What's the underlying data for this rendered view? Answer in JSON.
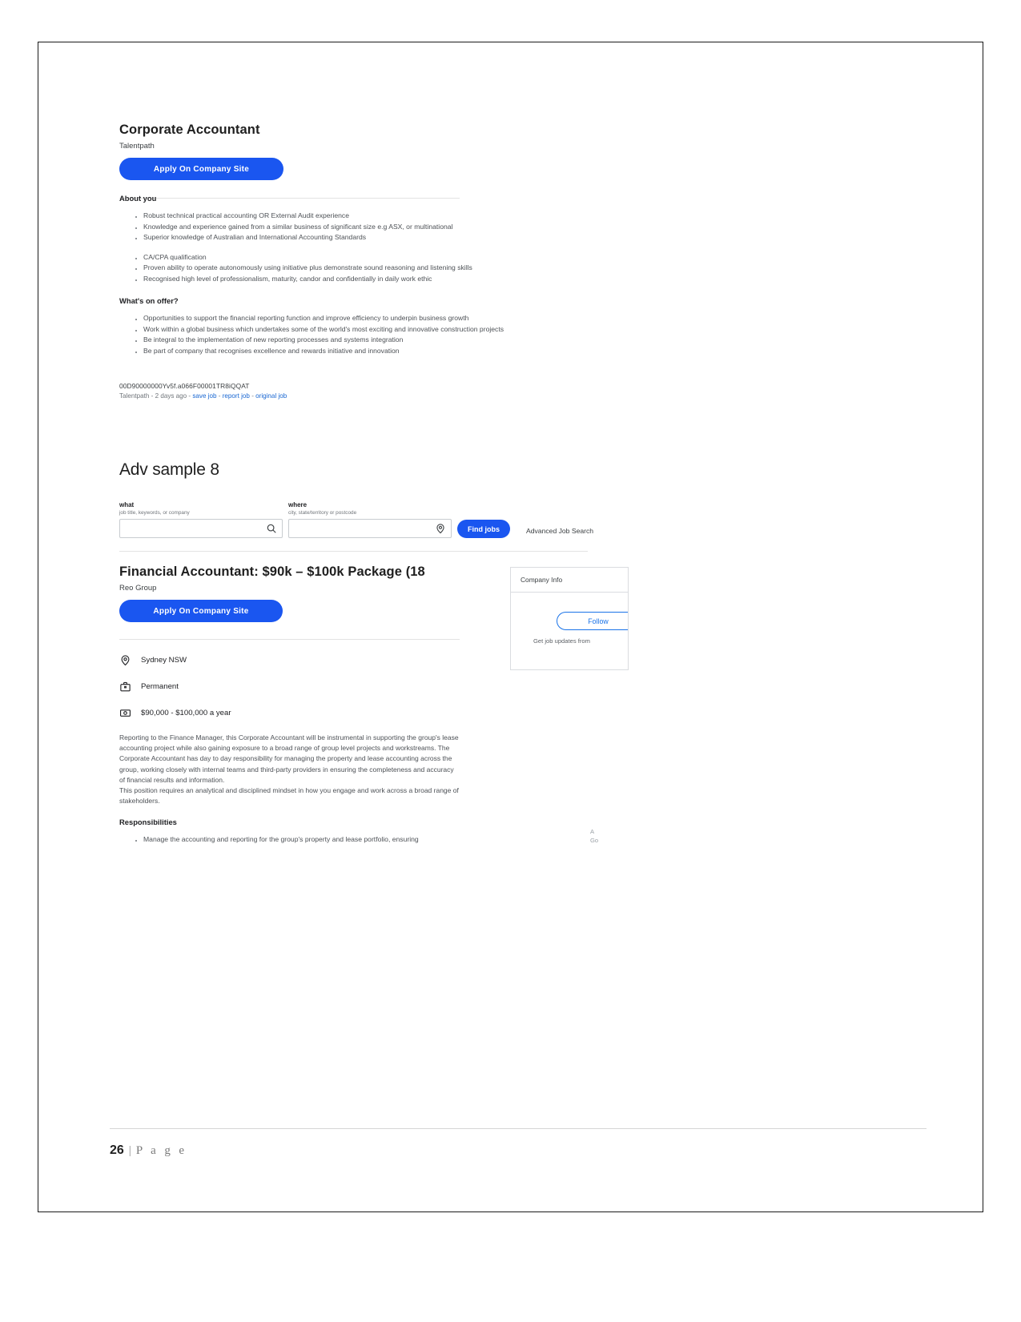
{
  "page": {
    "number": "26",
    "separator": "|",
    "word": "P a g e"
  },
  "job1": {
    "title": "Corporate Accountant",
    "company": "Talentpath",
    "apply_label": "Apply On Company Site",
    "about_heading": "About you",
    "about_bullets": [
      "Robust technical practical accounting OR External Audit experience",
      "Knowledge and experience gained from a similar business of significant size e.g ASX, or multinational",
      "Superior knowledge of Australian and International Accounting Standards"
    ],
    "about_bullets_b": [
      "CA/CPA qualification",
      "Proven ability to operate autonomously using initiative plus demonstrate sound reasoning and listening skills",
      "Recognised high level of professionalism, maturity, candor and confidentially in daily work ethic"
    ],
    "offer_heading": "What's on offer?",
    "offer_bullets": [
      "Opportunities to support the financial reporting function and improve efficiency to underpin business growth",
      "Work within a global business which undertakes some of the world's most exciting and innovative construction projects",
      "Be integral to the implementation of new reporting processes and systems integration",
      "Be part of company that recognises excellence and rewards initiative and innovation"
    ],
    "job_id": "00D90000000Yv5f.a066F00001TR8iQQAT",
    "meta_company": "Talentpath",
    "meta_age": "2 days ago",
    "meta_links": [
      "save job",
      "report job",
      "original job"
    ],
    "meta_dash": "-"
  },
  "adv_heading": "Adv sample 8",
  "search": {
    "what_label": "what",
    "what_hint": "job title, keywords, or company",
    "what_value": "",
    "what_placeholder": "",
    "where_label": "where",
    "where_hint": "city, state/territory or postcode",
    "where_value": "",
    "where_placeholder": "",
    "find_jobs_label": "Find jobs",
    "advanced_label": "Advanced Job Search",
    "search_icon": "search-icon",
    "location_icon": "location-pin-icon"
  },
  "job2": {
    "title": "Financial Accountant: $90k – $100k Package (18",
    "company": "Reo Group",
    "apply_label": "Apply On Company Site",
    "facts": [
      {
        "icon": "location-pin-icon",
        "text": "Sydney NSW"
      },
      {
        "icon": "briefcase-icon",
        "text": "Permanent"
      },
      {
        "icon": "money-icon",
        "text": "$90,000 - $100,000 a year"
      }
    ],
    "description_p1": "Reporting to the Finance Manager, this Corporate Accountant will be instrumental in supporting the group's lease accounting project while also gaining exposure to a broad range of group level projects and workstreams. The Corporate Accountant has day to day responsibility for managing the property and lease accounting across the group, working closely with internal teams and third-party providers in ensuring the completeness and accuracy of financial results and information.",
    "description_p2": "This position requires an analytical and disciplined mindset in how you engage and work across a broad range of stakeholders.",
    "responsibilities_heading": "Responsibilities",
    "responsibilities": [
      "Manage the accounting and reporting for the group's property and lease portfolio, ensuring"
    ]
  },
  "company_card": {
    "header": "Company Info",
    "follow_label": "Follow",
    "subtext": "Get job updates from",
    "fragment_line1": "A",
    "fragment_line2": "Go"
  },
  "colors": {
    "accent_blue": "#1a56f0",
    "link_blue": "#1967d2",
    "body_text": "#4d5156",
    "heading": "#202124"
  }
}
